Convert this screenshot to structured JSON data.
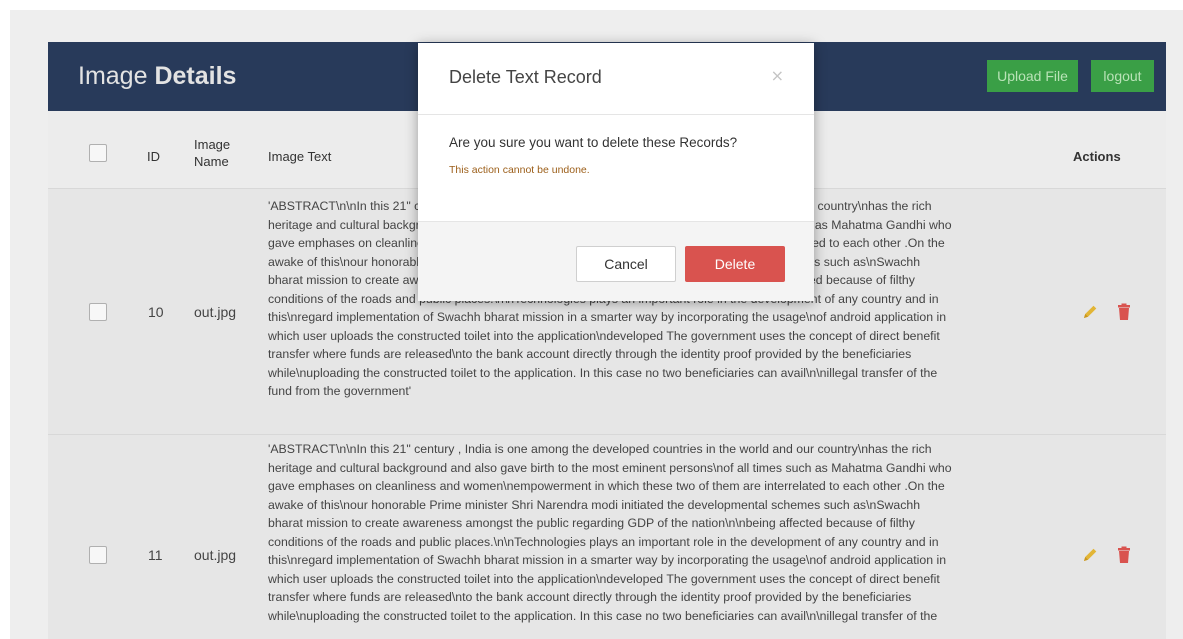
{
  "header": {
    "title_light": "Image",
    "title_bold": "Details",
    "upload_label": "Upload File",
    "logout_label": "logout"
  },
  "table": {
    "columns": {
      "id": "ID",
      "image_name_line1": "Image",
      "image_name_line2": "Name",
      "image_text": "Image Text",
      "actions": "Actions"
    },
    "rows": [
      {
        "id": "10",
        "image_name": "out.jpg",
        "lines": [
          "'ABSTRACT\\n\\nIn this 21\" century , India is one among the developed countries in the world and our country\\nhas the rich",
          "heritage and cultural background and also gave birth to the most eminent persons\\nof all times such as Mahatma Gandhi who",
          "gave emphases on cleanliness and women\\nempowerment in which these two of them are interrelated to each other .On the",
          "awake of this\\nour honorable Prime minister Shri Narendra modi initiated the developmental schemes such as\\nSwachh",
          "bharat mission to create awareness amongst the public regarding GDP of the nation\\n\\nbeing affected because of filthy",
          "conditions of the roads and public places.\\n\\nTechnologies plays an important role in the development of any country and in",
          "this\\nregard implementation of Swachh bharat mission in a smarter way by incorporating the usage\\nof android application in",
          "which user uploads the constructed toilet into the application\\ndeveloped The government uses the concept of direct benefit",
          "transfer where funds are released\\nto the bank account directly through the identity proof provided by the beneficiaries",
          "while\\nuploading the constructed toilet to the application. In this case no two beneficiaries can avail\\n\\nillegal transfer of the",
          "fund from the government'"
        ]
      },
      {
        "id": "11",
        "image_name": "out.jpg",
        "lines": [
          "'ABSTRACT\\n\\nIn this 21\" century , India is one among the developed countries in the world and our country\\nhas the rich",
          "heritage and cultural background and also gave birth to the most eminent persons\\nof all times such as Mahatma Gandhi who",
          "gave emphases on cleanliness and women\\nempowerment in which these two of them are interrelated to each other .On the",
          "awake of this\\nour honorable Prime minister Shri Narendra modi initiated the developmental schemes such as\\nSwachh",
          "bharat mission to create awareness amongst the public regarding GDP of the nation\\n\\nbeing affected because of filthy",
          "conditions of the roads and public places.\\n\\nTechnologies plays an important role in the development of any country and in",
          "this\\nregard implementation of Swachh bharat mission in a smarter way by incorporating the usage\\nof android application in",
          "which user uploads the constructed toilet into the application\\ndeveloped The government uses the concept of direct benefit",
          "transfer where funds are released\\nto the bank account directly through the identity proof provided by the beneficiaries",
          "while\\nuploading the constructed toilet to the application. In this case no two beneficiaries can avail\\n\\nillegal transfer of the"
        ]
      }
    ]
  },
  "modal": {
    "title": "Delete Text Record",
    "close_glyph": "×",
    "question": "Are you sure you want to delete these Records?",
    "warning": "This action cannot be undone.",
    "cancel_label": "Cancel",
    "delete_label": "Delete"
  },
  "colors": {
    "header_bg": "#283a5a",
    "upload_button": "#3a9f46",
    "delete_button": "#d9534f",
    "edit_icon": "#e2b536",
    "trash_icon": "#d9534f"
  }
}
